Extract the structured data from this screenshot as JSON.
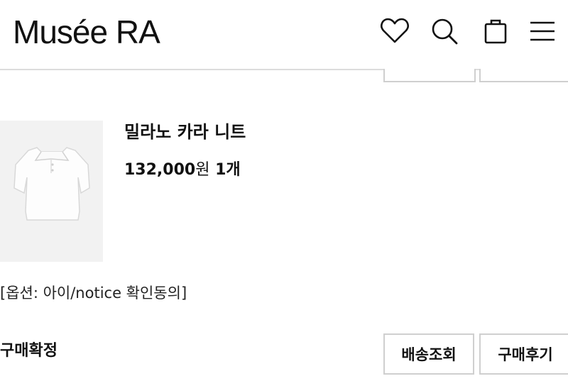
{
  "header": {
    "logo": "Musée RA",
    "icons": [
      "heart-icon",
      "search-icon",
      "bag-icon",
      "menu-icon"
    ]
  },
  "order_item": {
    "product_name": "밀라노 카라 니트",
    "price": "132,000",
    "currency": "원",
    "quantity": "1개",
    "option": "[옵션: 아이/notice 확인동의]",
    "status": "구매확정",
    "buttons": {
      "tracking": "배송조회",
      "review": "구매후기"
    }
  }
}
